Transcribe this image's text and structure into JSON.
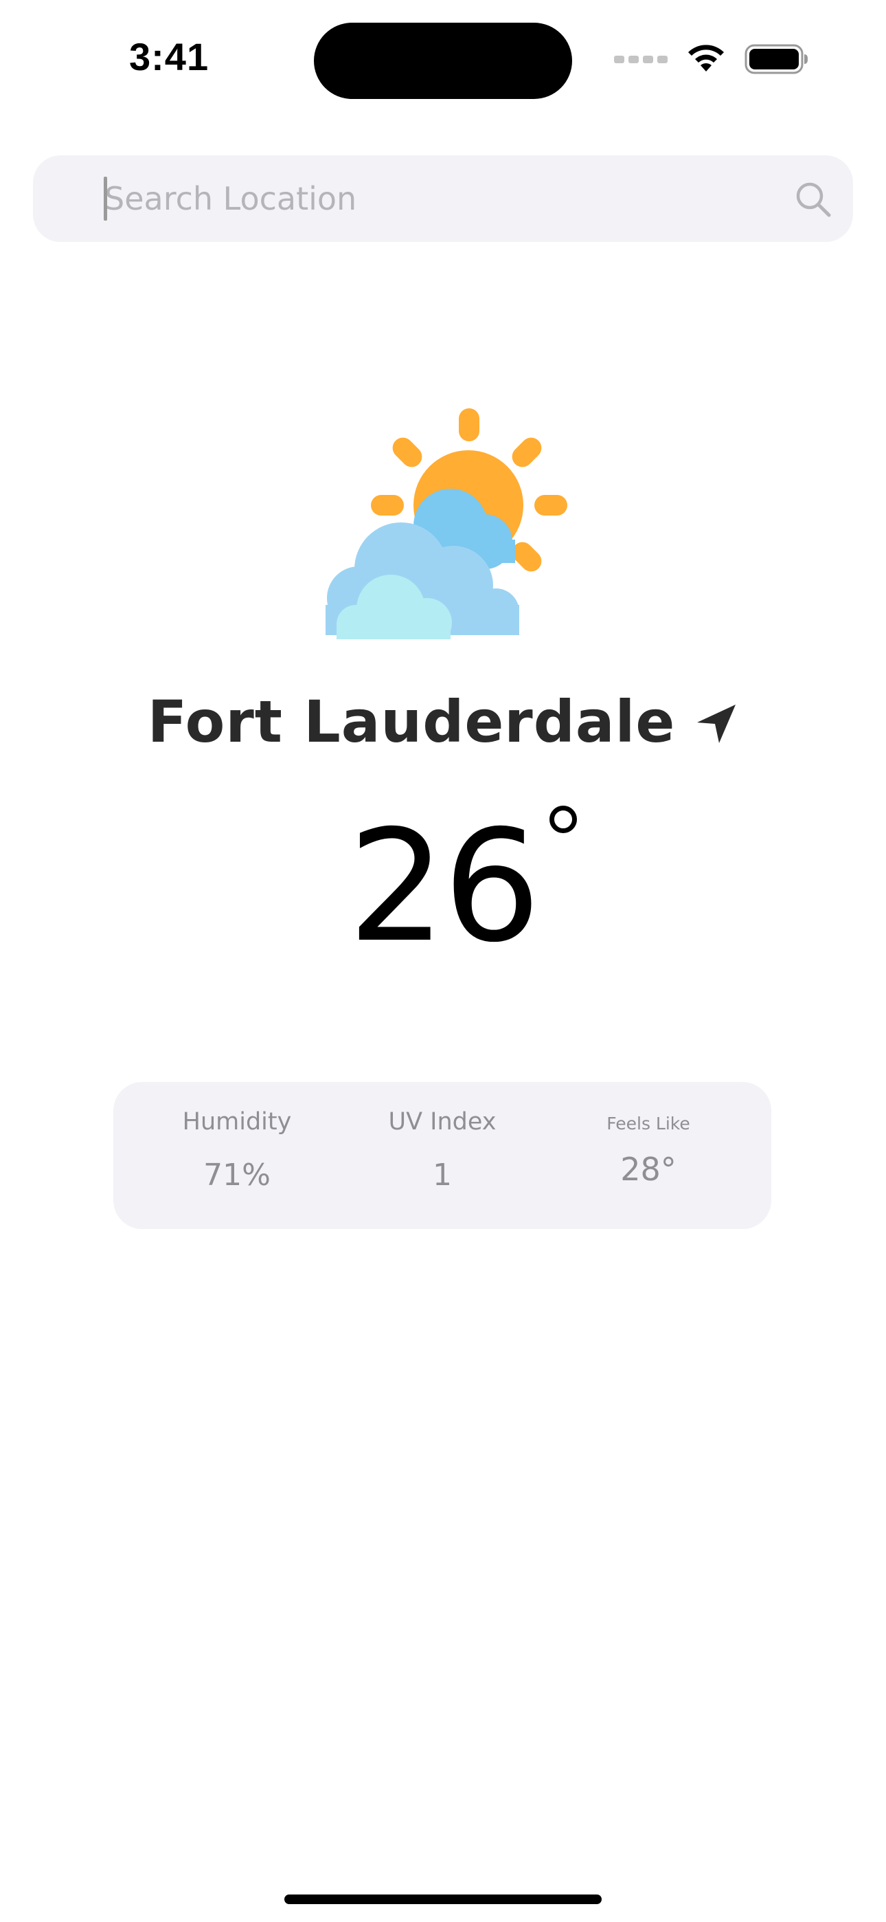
{
  "status_bar": {
    "time": "3:41",
    "icons": [
      "cellular-signal-icon",
      "wifi-icon",
      "battery-icon"
    ]
  },
  "search": {
    "placeholder": "Search Location",
    "value": "",
    "icon": "search-icon"
  },
  "weather": {
    "condition_icon": "partly-cloudy-icon",
    "location": "Fort Lauderdale",
    "location_icon": "location-arrow-icon",
    "temperature": "26"
  },
  "stats": [
    {
      "label": "Humidity",
      "value": "71%"
    },
    {
      "label": "UV Index",
      "value": "1"
    },
    {
      "label": "Feels Like",
      "value": "28°"
    }
  ],
  "colors": {
    "sun": "#FFAD33",
    "cloud_back": "#7BC8F0",
    "cloud_mid": "#9DD3F2",
    "cloud_front": "#B3ECF2",
    "card_background": "#F2F2F7",
    "muted_text": "#8E8E93",
    "heading_text": "#2A2A2A"
  }
}
